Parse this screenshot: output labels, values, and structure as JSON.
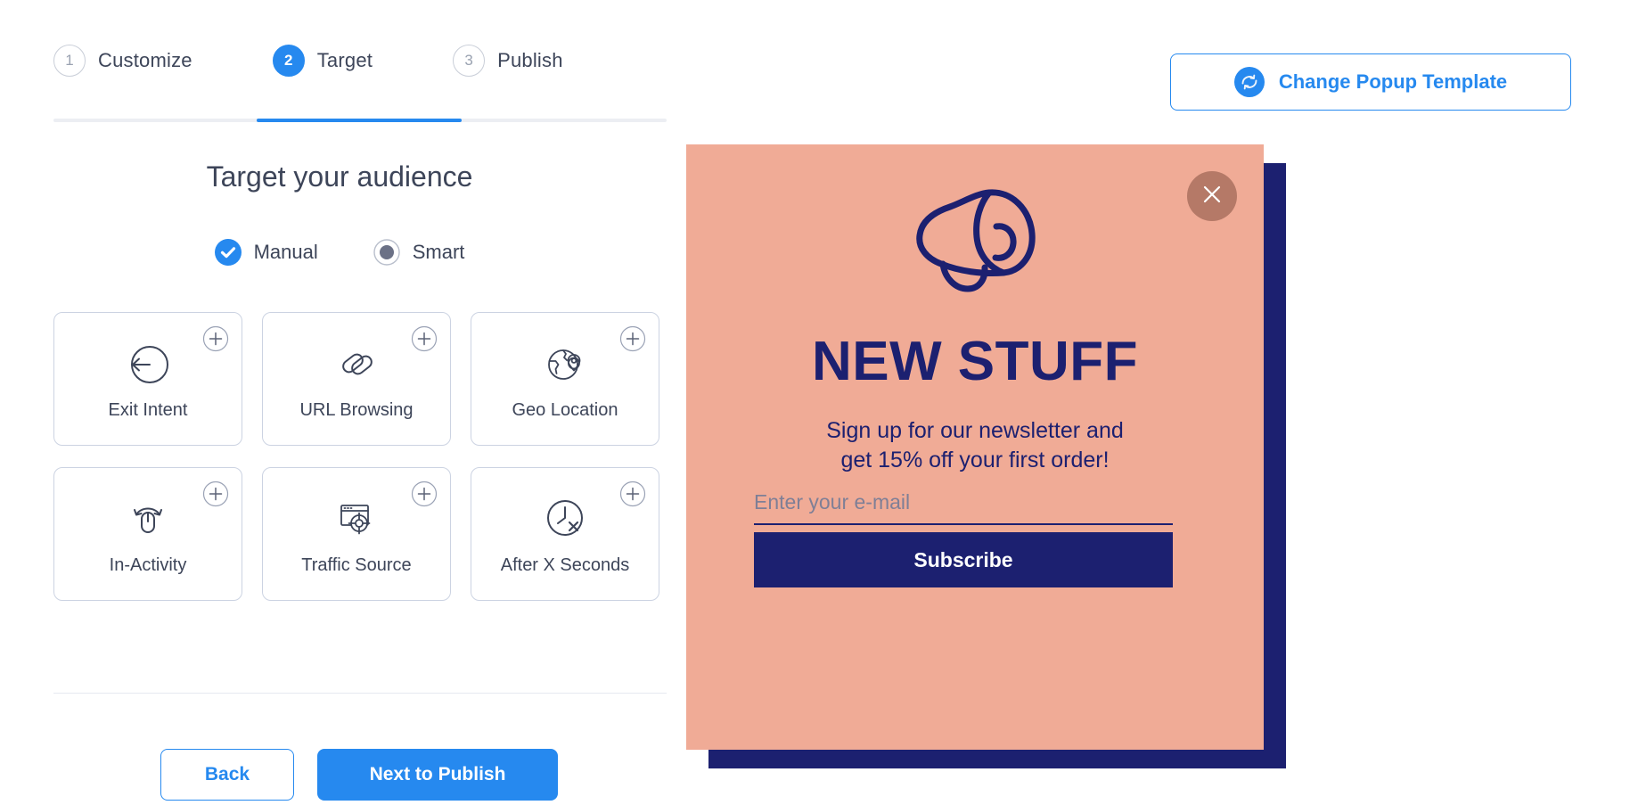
{
  "stepper": {
    "steps": [
      {
        "number": "1",
        "label": "Customize",
        "active": false
      },
      {
        "number": "2",
        "label": "Target",
        "active": true
      },
      {
        "number": "3",
        "label": "Publish",
        "active": false
      }
    ]
  },
  "header": {
    "change_template_label": "Change Popup Template",
    "change_template_icon": "refresh-icon"
  },
  "panel": {
    "title": "Target your audience",
    "modes": [
      {
        "label": "Manual",
        "selected": true,
        "icon": "check-circle-icon"
      },
      {
        "label": "Smart",
        "selected": false,
        "icon": "radio-dot-icon"
      }
    ],
    "cards": [
      {
        "label": "Exit Intent",
        "icon": "exit-intent-icon",
        "add_icon": "plus-circle-icon"
      },
      {
        "label": "URL Browsing",
        "icon": "link-icon",
        "add_icon": "plus-circle-icon"
      },
      {
        "label": "Geo Location",
        "icon": "geo-location-icon",
        "add_icon": "plus-circle-icon"
      },
      {
        "label": "In-Activity",
        "icon": "mouse-icon",
        "add_icon": "plus-circle-icon"
      },
      {
        "label": "Traffic Source",
        "icon": "traffic-source-icon",
        "add_icon": "plus-circle-icon"
      },
      {
        "label": "After X Seconds",
        "icon": "clock-x-icon",
        "add_icon": "plus-circle-icon"
      }
    ],
    "footer": {
      "back_label": "Back",
      "next_label": "Next to Publish"
    }
  },
  "popup_preview": {
    "heading": "NEW STUFF",
    "subtext": "Sign up for our newsletter and get 15% off your first order!",
    "subtext_line1": "Sign up for our newsletter and",
    "subtext_line2": "get 15% off your first order!",
    "email_placeholder": "Enter your e-mail",
    "email_value": "",
    "submit_label": "Subscribe",
    "close_icon": "close-icon",
    "hero_icon": "megaphone-icon"
  },
  "colors": {
    "accent_blue": "#2689ef",
    "text_slate": "#3d4559",
    "popup_bg": "#f0ab96",
    "popup_navy": "#1c2070",
    "card_border": "#ccd3e2"
  }
}
